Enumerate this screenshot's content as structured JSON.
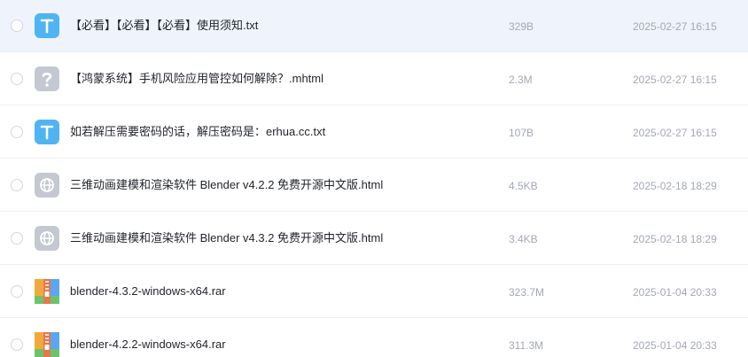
{
  "files": [
    {
      "name": "【必看】【必看】【必看】使用须知.txt",
      "size": "329B",
      "modified": "2025-02-27 16:15",
      "icon": "txt-file-icon",
      "icon_color": "#4fb4f2",
      "selected": true
    },
    {
      "name": "【鸿蒙系统】手机风险应用管控如何解除？.mhtml",
      "size": "2.3M",
      "modified": "2025-02-27 16:15",
      "icon": "unknown-file-icon",
      "icon_color": "#c4c8d0",
      "selected": false
    },
    {
      "name": "如若解压需要密码的话，解压密码是：erhua.cc.txt",
      "size": "107B",
      "modified": "2025-02-27 16:15",
      "icon": "txt-file-icon",
      "icon_color": "#4fb4f2",
      "selected": false
    },
    {
      "name": "三维动画建模和渲染软件 Blender v4.2.2 免费开源中文版.html",
      "size": "4.5KB",
      "modified": "2025-02-18 18:29",
      "icon": "web-file-icon",
      "icon_color": "#c4c8d0",
      "selected": false
    },
    {
      "name": "三维动画建模和渲染软件 Blender v4.3.2 免费开源中文版.html",
      "size": "3.4KB",
      "modified": "2025-02-18 18:29",
      "icon": "web-file-icon",
      "icon_color": "#c4c8d0",
      "selected": false
    },
    {
      "name": "blender-4.3.2-windows-x64.rar",
      "size": "323.7M",
      "modified": "2025-01-04 20:33",
      "icon": "archive-file-icon",
      "icon_color": "#e8774b",
      "selected": false
    },
    {
      "name": "blender-4.2.2-windows-x64.rar",
      "size": "311.3M",
      "modified": "2025-01-04 20:33",
      "icon": "archive-file-icon",
      "icon_color": "#e8774b",
      "selected": false
    }
  ]
}
